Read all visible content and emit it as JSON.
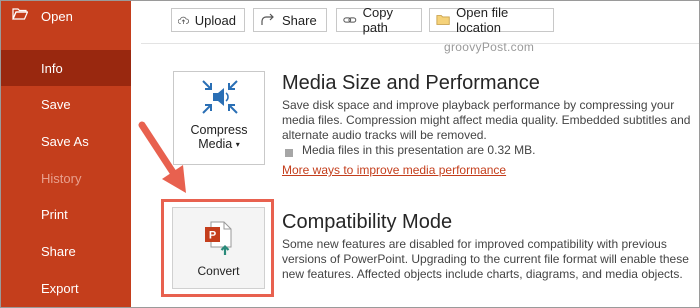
{
  "sidebar": {
    "items": [
      {
        "label": "Open",
        "state": "normal",
        "icon": "folder-open-icon"
      },
      {
        "label": "Info",
        "state": "active"
      },
      {
        "label": "Save",
        "state": "normal"
      },
      {
        "label": "Save As",
        "state": "normal"
      },
      {
        "label": "History",
        "state": "disabled"
      },
      {
        "label": "Print",
        "state": "normal"
      },
      {
        "label": "Share",
        "state": "normal"
      },
      {
        "label": "Export",
        "state": "normal"
      }
    ],
    "color": "#c43e1c",
    "active_color": "#99280f"
  },
  "toolbar": {
    "upload_label": "Upload",
    "share_label": "Share",
    "copy_path_label": "Copy path",
    "open_location_label": "Open file location"
  },
  "watermark": "groovyPost.com",
  "media": {
    "button_label_line1": "Compress",
    "button_label_line2": "Media",
    "title": "Media Size and Performance",
    "description": "Save disk space and improve playback performance by compressing your media files. Compression might affect media quality. Embedded subtitles and alternate audio tracks will be removed.",
    "stat": "Media files in this presentation are 0.32 MB.",
    "link": "More ways to improve media performance"
  },
  "compat": {
    "button_label": "Convert",
    "title": "Compatibility Mode",
    "description": "Some new features are disabled for improved compatibility with previous versions of PowerPoint. Upgrading to the current file format will enable these new features. Affected objects include charts, diagrams, and media objects.",
    "highlight_color": "#e8614f"
  }
}
